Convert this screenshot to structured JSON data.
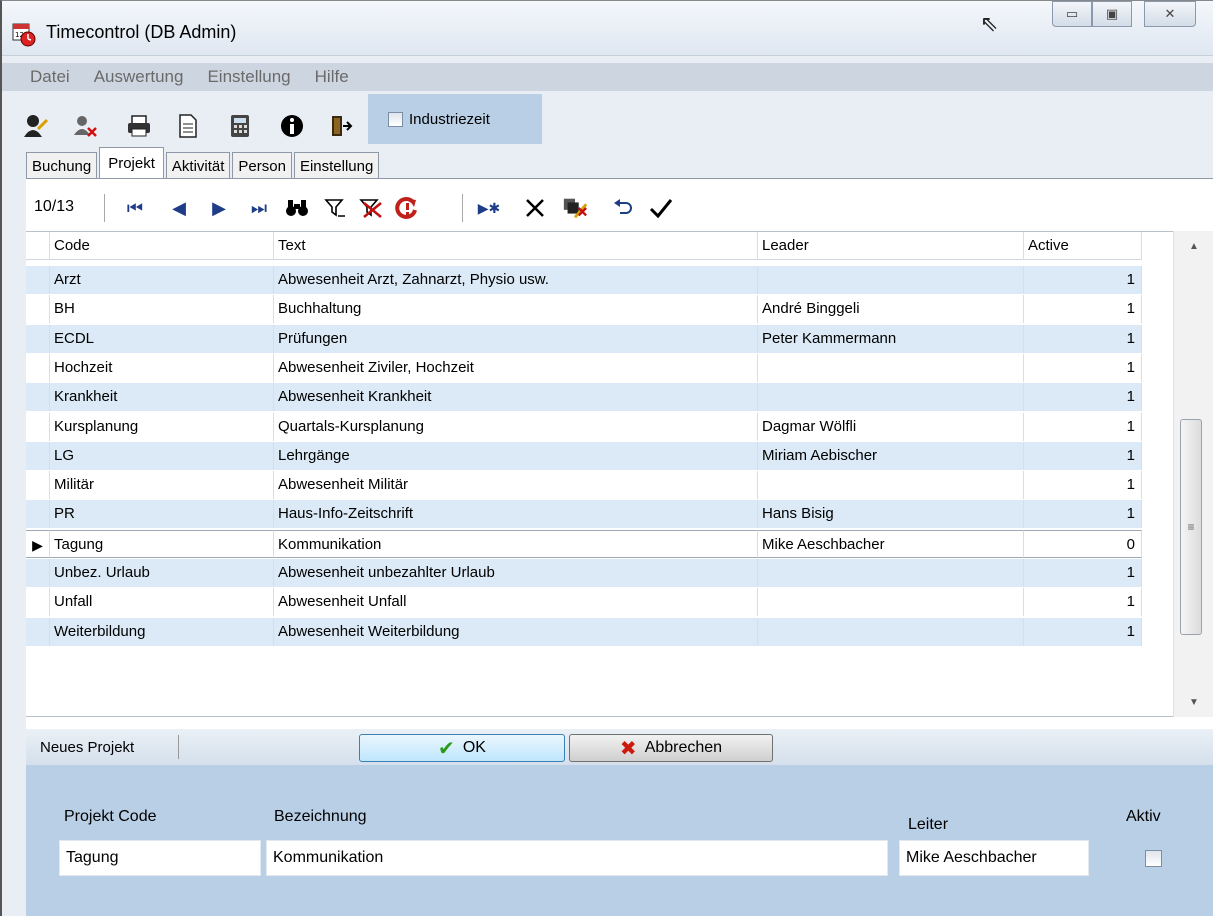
{
  "window": {
    "title": "Timecontrol (DB Admin)",
    "app_icon": "calendar-clock-icon",
    "controls": [
      "minimize-icon",
      "maximize-icon",
      "close-icon"
    ]
  },
  "menu": [
    "Datei",
    "Auswertung",
    "Einstellung",
    "Hilfe"
  ],
  "toolbar": {
    "icons": [
      "user-edit-icon",
      "user-delete-icon",
      "printer-icon",
      "document-icon",
      "calculator-icon",
      "info-icon",
      "exit-door-icon"
    ],
    "industriezeit_label": "Industriezeit",
    "industriezeit_checked": false
  },
  "tabs": [
    {
      "label": "Buchung",
      "active": false
    },
    {
      "label": "Projekt",
      "active": true
    },
    {
      "label": "Aktivität",
      "active": false
    },
    {
      "label": "Person",
      "active": false
    },
    {
      "label": "Einstellung",
      "active": false
    }
  ],
  "navigator": {
    "record_position": "10/13",
    "icons": [
      "first-record-icon",
      "previous-record-icon",
      "next-record-icon",
      "last-record-icon",
      "find-icon",
      "filter-icon",
      "clear-filter-icon",
      "refresh-icon",
      "new-record-icon",
      "delete-record-icon",
      "edit-fields-icon",
      "undo-icon",
      "save-check-icon"
    ]
  },
  "grid": {
    "columns": [
      "Code",
      "Text",
      "Leader",
      "Active"
    ],
    "current_row_index": 9,
    "rows": [
      {
        "code": "Arzt",
        "text": "Abwesenheit Arzt, Zahnarzt, Physio usw.",
        "leader": "",
        "active": "1"
      },
      {
        "code": "BH",
        "text": "Buchhaltung",
        "leader": "André Binggeli",
        "active": "1"
      },
      {
        "code": "ECDL",
        "text": "Prüfungen",
        "leader": "Peter Kammermann",
        "active": "1"
      },
      {
        "code": "Hochzeit",
        "text": "Abwesenheit Ziviler, Hochzeit",
        "leader": "",
        "active": "1"
      },
      {
        "code": "Krankheit",
        "text": "Abwesenheit Krankheit",
        "leader": "",
        "active": "1"
      },
      {
        "code": "Kursplanung",
        "text": "Quartals-Kursplanung",
        "leader": "Dagmar Wölfli",
        "active": "1"
      },
      {
        "code": "LG",
        "text": "Lehrgänge",
        "leader": "Miriam Aebischer",
        "active": "1"
      },
      {
        "code": "Militär",
        "text": "Abwesenheit Militär",
        "leader": "",
        "active": "1"
      },
      {
        "code": "PR",
        "text": "Haus-Info-Zeitschrift",
        "leader": "Hans Bisig",
        "active": "1"
      },
      {
        "code": "Tagung",
        "text": "Kommunikation",
        "leader": "Mike Aeschbacher",
        "active": "0"
      },
      {
        "code": "Unbez. Urlaub",
        "text": "Abwesenheit unbezahlter Urlaub",
        "leader": "",
        "active": "1"
      },
      {
        "code": "Unfall",
        "text": "Abwesenheit Unfall",
        "leader": "",
        "active": "1"
      },
      {
        "code": "Weiterbildung",
        "text": "Abwesenheit Weiterbildung",
        "leader": "",
        "active": "1"
      }
    ]
  },
  "edit_bar": {
    "label": "Neues Projekt",
    "ok_label": "OK",
    "cancel_label": "Abbrechen"
  },
  "form": {
    "code_label": "Projekt Code",
    "code_value": "Tagung",
    "bezeichnung_label": "Bezeichnung",
    "bezeichnung_value": "Kommunikation",
    "leiter_label": "Leiter",
    "leiter_value": "Mike Aeschbacher",
    "aktiv_label": "Aktiv",
    "aktiv_checked": false
  }
}
